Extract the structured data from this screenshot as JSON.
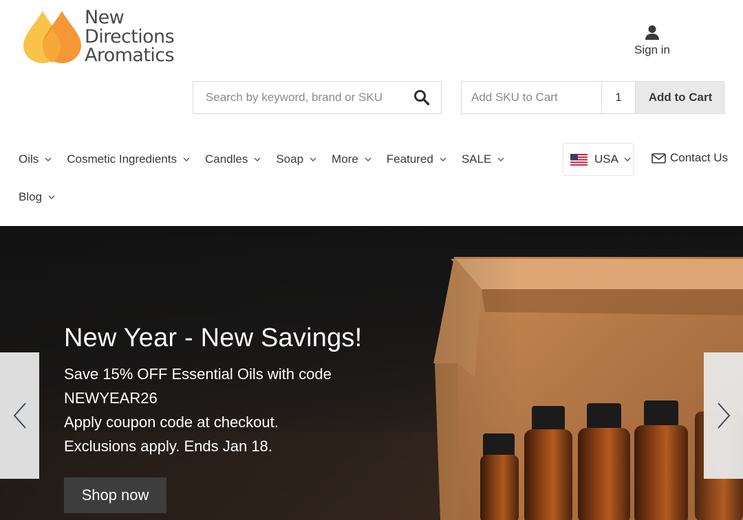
{
  "brand": {
    "line1": "New",
    "line2": "Directions",
    "line3": "Aromatics"
  },
  "account": {
    "signin_label": "Sign in"
  },
  "search": {
    "placeholder": "Search by keyword, brand or SKU"
  },
  "sku": {
    "placeholder": "Add SKU to Cart",
    "quantity": "1",
    "add_label": "Add to Cart"
  },
  "nav": {
    "items": [
      {
        "label": "Oils"
      },
      {
        "label": "Cosmetic Ingredients"
      },
      {
        "label": "Candles"
      },
      {
        "label": "Soap"
      },
      {
        "label": "More"
      },
      {
        "label": "Featured"
      },
      {
        "label": "SALE"
      },
      {
        "label": "Blog"
      }
    ],
    "region_label": "USA",
    "region_icon": "us-flag-icon",
    "contact_label": "Contact Us"
  },
  "hero": {
    "title": "New Year - New Savings!",
    "line1": "Save 15% OFF Essential Oils with code",
    "line2": "NEWYEAR26",
    "line3": "Apply coupon code at checkout.",
    "line4": "Exclusions apply. Ends Jan 18.",
    "cta": "Shop now"
  },
  "colors": {
    "logo_orange": "#f5912b",
    "logo_yellow": "#f9c349",
    "button_gray": "#e9e9e9",
    "hero_button": "#3d3d3d"
  }
}
